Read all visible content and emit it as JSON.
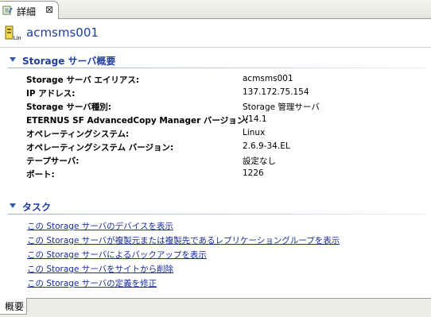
{
  "view_tab": {
    "label": "詳細",
    "close_glyph": "⊠",
    "icon": "detail-view-icon"
  },
  "header": {
    "title": "acmsms001",
    "icon": "linux-server-icon",
    "icon_badge": "Lin"
  },
  "overview": {
    "title": "Storage サーバ概要",
    "properties": [
      {
        "key": "Storage サーバ エイリアス:",
        "value": "acmsms001"
      },
      {
        "key": "IP アドレス:",
        "value": "137.172.75.154"
      },
      {
        "key": "Storage サーバ種別:",
        "value": "Storage 管理サーバ"
      },
      {
        "key": "ETERNUS SF AdvancedCopy Manager バージョン:",
        "value": "V14.1"
      },
      {
        "key": "オペレーティングシステム:",
        "value": "Linux"
      },
      {
        "key": "オペレーティングシステム バージョン:",
        "value": "2.6.9-34.EL"
      },
      {
        "key": "テープサーバ:",
        "value": "設定なし"
      },
      {
        "key": "ポート:",
        "value": "1226"
      }
    ]
  },
  "tasks": {
    "title": "タスク",
    "links": [
      "この Storage サーバのデバイスを表示",
      "この Storage サーバが複製元または複製先であるレプリケーショングループを表示",
      "この Storage サーバによるバックアップを表示",
      "この Storage サーバをサイトから削除",
      "この Storage サーバの定義を修正"
    ]
  },
  "bottom_tabs": [
    {
      "label": "概要",
      "active": true
    }
  ],
  "colors": {
    "title_blue": "#1f3e9b",
    "link_blue": "#1a2c99"
  }
}
